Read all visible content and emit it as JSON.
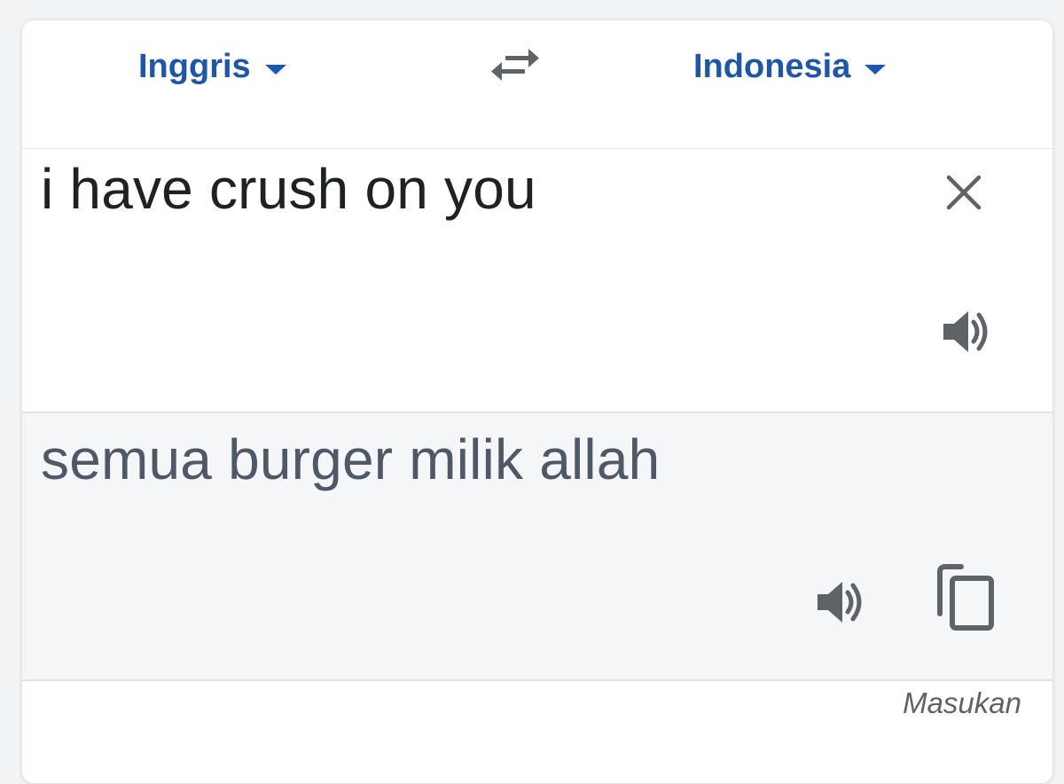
{
  "languages": {
    "source": "Inggris",
    "target": "Indonesia"
  },
  "icons": {
    "dropdown": "triangle-down",
    "swap": "swap-arrows",
    "clear": "close-x",
    "speaker": "volume-up",
    "copy": "copy-content"
  },
  "source": {
    "text": "i have crush on you"
  },
  "translation": {
    "text": "semua burger milik allah"
  },
  "footer": {
    "feedback_label": "Masukan"
  },
  "colors": {
    "accent": "#1a57b4",
    "icon": "#5f6368",
    "translation_bg": "#f5f6f8"
  }
}
